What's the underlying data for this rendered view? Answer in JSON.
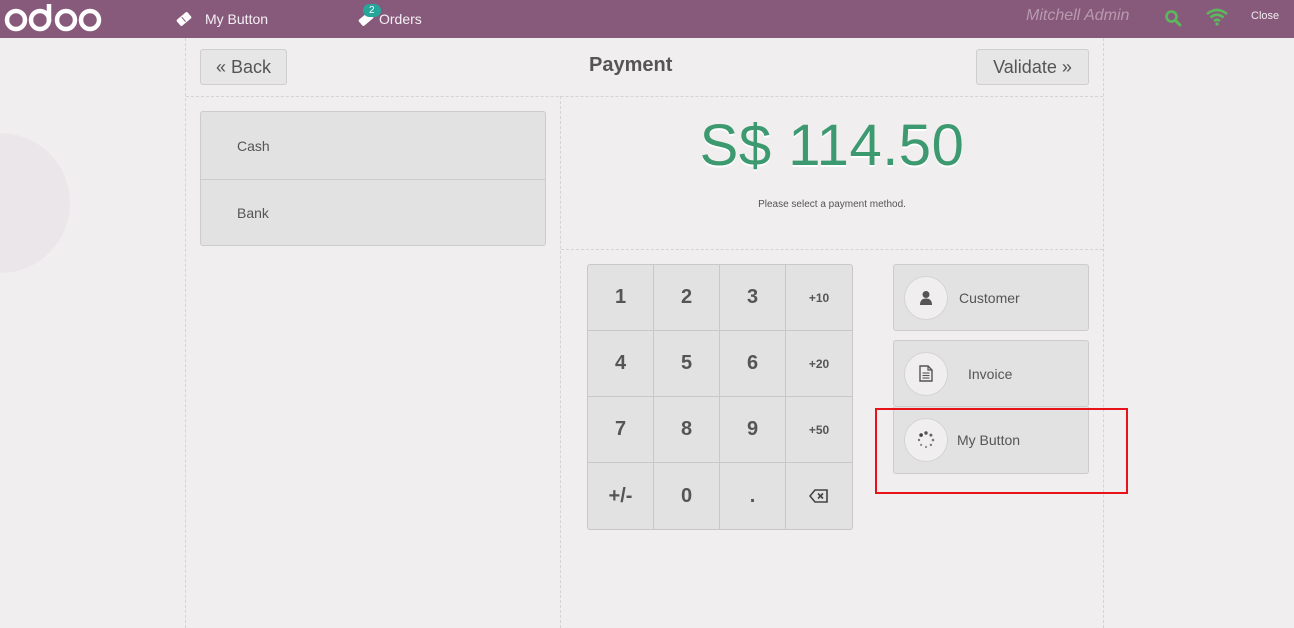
{
  "navbar": {
    "logo_text": "odoo",
    "items": [
      {
        "label": "My Button",
        "icon": "ticket-icon"
      },
      {
        "label": "Orders",
        "icon": "ticket-icon",
        "badge": "2"
      }
    ],
    "username": "Mitchell Admin",
    "close_label": "Close",
    "color": "#875a7b",
    "status_color": "#5cb85c"
  },
  "header": {
    "back_label": "« Back",
    "title": "Payment",
    "validate_label": "Validate »"
  },
  "payment_methods": [
    {
      "label": "Cash"
    },
    {
      "label": "Bank"
    }
  ],
  "total": {
    "amount": "S$ 114.50",
    "hint": "Please select a payment method.",
    "color": "#3d9970"
  },
  "numpad": {
    "keys": [
      "1",
      "2",
      "3",
      "+10",
      "4",
      "5",
      "6",
      "+20",
      "7",
      "8",
      "9",
      "+50",
      "+/-",
      "0",
      ".",
      "⌫"
    ]
  },
  "actions": [
    {
      "label": "Customer",
      "icon": "user-icon"
    },
    {
      "label": "Invoice",
      "icon": "file-icon"
    },
    {
      "label": "My Button",
      "icon": "spinner-icon"
    }
  ],
  "highlight_color": "#e8121b"
}
